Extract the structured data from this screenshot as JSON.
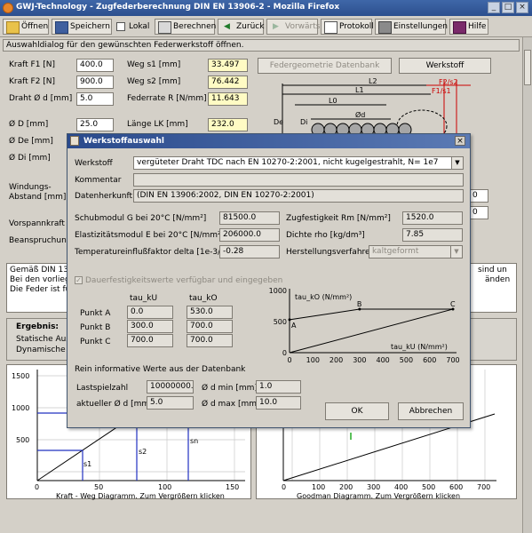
{
  "window": {
    "title": "GWJ-Technology - Zugfederberechnung DIN EN 13906-2 - Mozilla Firefox"
  },
  "toolbar": {
    "open": "Öffnen",
    "save": "Speichern",
    "local": "Lokal",
    "calculate": "Berechnen",
    "back": "Zurück",
    "forward": "Vorwärts",
    "protocol": "Protokoll",
    "settings": "Einstellungen",
    "help": "Hilfe"
  },
  "status": "Auswahldialog für den gewünschten Federwerkstoff öffnen.",
  "form": {
    "f1_label": "Kraft F1 [N]",
    "f1_value": "400.0",
    "f2_label": "Kraft F2 [N]",
    "f2_value": "900.0",
    "d_label": "Draht Ø d [mm]",
    "d_value": "5.0",
    "s1_label": "Weg s1 [mm]",
    "s1_value": "33.497",
    "s2_label": "Weg s2 [mm]",
    "s2_value": "76.442",
    "r_label": "Federrate R [N/mm]",
    "r_value": "11.643",
    "D_label": "Ø D [mm]",
    "D_value": "25.0",
    "De_label": "Ø De [mm]",
    "Di_label": "Ø Di [mm]",
    "lk_label": "Länge LK [mm]",
    "lk_value": "232.0",
    "windungs_label1": "Windungs-",
    "windungs_label2": "Abstand [mm]",
    "vorspann_label": "Vorspannkraft F",
    "beanspruchung_label": "Beanspruchung",
    "geometry_db_button": "Federgeometrie Datenbank",
    "material_button": "Werkstoff",
    "partial_right_value1": "0",
    "partial_right_value2": "0"
  },
  "drawing_labels": {
    "l2": "L2",
    "l1": "L1",
    "l0": "L0",
    "f2s2": "F2/s2",
    "f1s1": "F1/s1",
    "de": "De",
    "di": "Di",
    "d": "Ød"
  },
  "notes": {
    "line1": "Gemäß DIN 13",
    "line2": "Bei den vorlieg",
    "line3": "Die Feder ist fü",
    "right1": "sind un",
    "right2": "änden"
  },
  "results": {
    "heading": "Ergebnis:",
    "line1": "Statische Aus",
    "line2": "Dynamische"
  },
  "bottom_charts": {
    "left_caption": "Kraft - Weg Diagramm. Zum Vergrößern klicken",
    "right_caption": "Goodman Diagramm. Zum Vergrößern klicken",
    "left_y_ticks": [
      "1500",
      "1000",
      "500"
    ],
    "left_x_ticks": [
      "0",
      "50",
      "100",
      "150"
    ],
    "left_markers": [
      "s1",
      "s2",
      "sn"
    ],
    "right_x_ticks": [
      "0",
      "100",
      "200",
      "300",
      "400",
      "500",
      "600",
      "700"
    ]
  },
  "dialog": {
    "title": "Werkstoffauswahl",
    "werkstoff_label": "Werkstoff",
    "werkstoff_value": "vergüteter Draht TDC nach EN 10270-2:2001, nicht kugelgestrahlt, N= 1e7",
    "kommentar_label": "Kommentar",
    "kommentar_value": "",
    "datenherkunft_label": "Datenherkunft",
    "datenherkunft_value": "(DIN EN 13906:2002, DIN EN 10270-2:2001)",
    "schubmodul_label": "Schubmodul G bei 20°C [N/mm²]",
    "schubmodul_value": "81500.0",
    "emodul_label": "Elastizitätsmodul E bei 20°C [N/mm²]",
    "emodul_value": "206000.0",
    "temp_label": "Temperatureinflußfaktor delta [1e-3/K]",
    "temp_value": "-0.28",
    "rm_label": "Zugfestigkeit Rm [N/mm²]",
    "rm_value": "1520.0",
    "rho_label": "Dichte rho [kg/dm³]",
    "rho_value": "7.85",
    "herstellung_label": "Herstellungsverfahren",
    "herstellung_value": "kaltgeformt",
    "dauer_checkbox": "Dauerfestigkeitswerte verfügbar und eingegeben",
    "col_tau_ku": "tau_kU",
    "col_tau_ko": "tau_kO",
    "punkte": [
      {
        "label": "Punkt A",
        "tau_ku": "0.0",
        "tau_ko": "530.0"
      },
      {
        "label": "Punkt B",
        "tau_ku": "300.0",
        "tau_ko": "700.0"
      },
      {
        "label": "Punkt C",
        "tau_ku": "700.0",
        "tau_ko": "700.0"
      }
    ],
    "info_heading": "Rein informative Werte aus der Datenbank",
    "lastspiel_label": "Lastspielzahl",
    "lastspiel_value": "10000000.0",
    "dmin_label": "Ø d min [mm]",
    "dmin_value": "1.0",
    "aktuell_label": "aktueller Ø d [mm]",
    "aktuell_value": "5.0",
    "dmax_label": "Ø d max [mm]",
    "dmax_value": "10.0",
    "ok_button": "OK",
    "cancel_button": "Abbrechen"
  },
  "chart_data": {
    "type": "line",
    "ylabel": "tau_kO (N/mm²)",
    "xlabel": "tau_kU (N/mm²)",
    "xlim": [
      0,
      700
    ],
    "ylim": [
      0,
      1000
    ],
    "x_ticks": [
      0,
      100,
      200,
      300,
      400,
      500,
      600,
      700
    ],
    "y_ticks": [
      0,
      500,
      1000
    ],
    "point_labels": [
      "A",
      "B",
      "C"
    ],
    "series": [
      {
        "x": [
          0,
          300,
          700
        ],
        "values": [
          530,
          700,
          700
        ]
      },
      {
        "x": [
          0,
          700
        ],
        "values": [
          0,
          700
        ]
      }
    ]
  }
}
